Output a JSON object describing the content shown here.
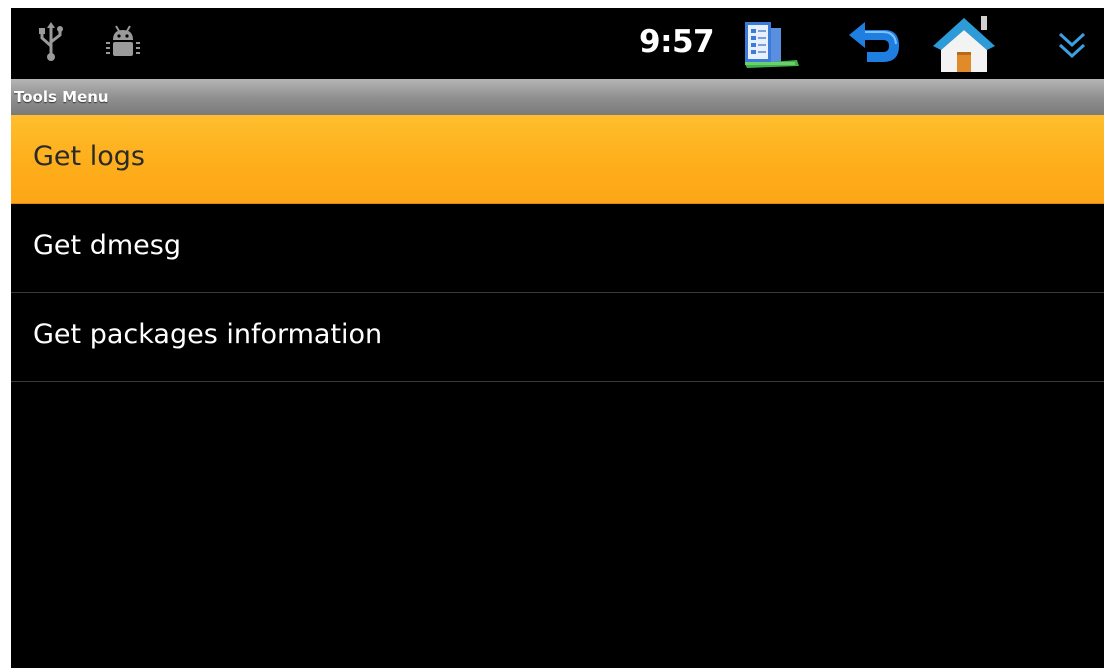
{
  "status_bar": {
    "time": "9:57",
    "icons": [
      "usb-icon",
      "android-debug-icon",
      "notes-app-icon",
      "back-icon",
      "home-icon",
      "menu-chevron-icon"
    ]
  },
  "title_bar": {
    "title": "Tools Menu"
  },
  "menu": {
    "items": [
      {
        "label": "Get logs",
        "selected": true
      },
      {
        "label": "Get dmesg",
        "selected": false
      },
      {
        "label": "Get packages information",
        "selected": false
      }
    ]
  },
  "colors": {
    "selected_bg": "#FEAE1B",
    "title_bar": "#9A9A9A",
    "background": "#000000",
    "back_icon_blue": "#1E7FE0",
    "home_roof": "#2C9BD8"
  }
}
